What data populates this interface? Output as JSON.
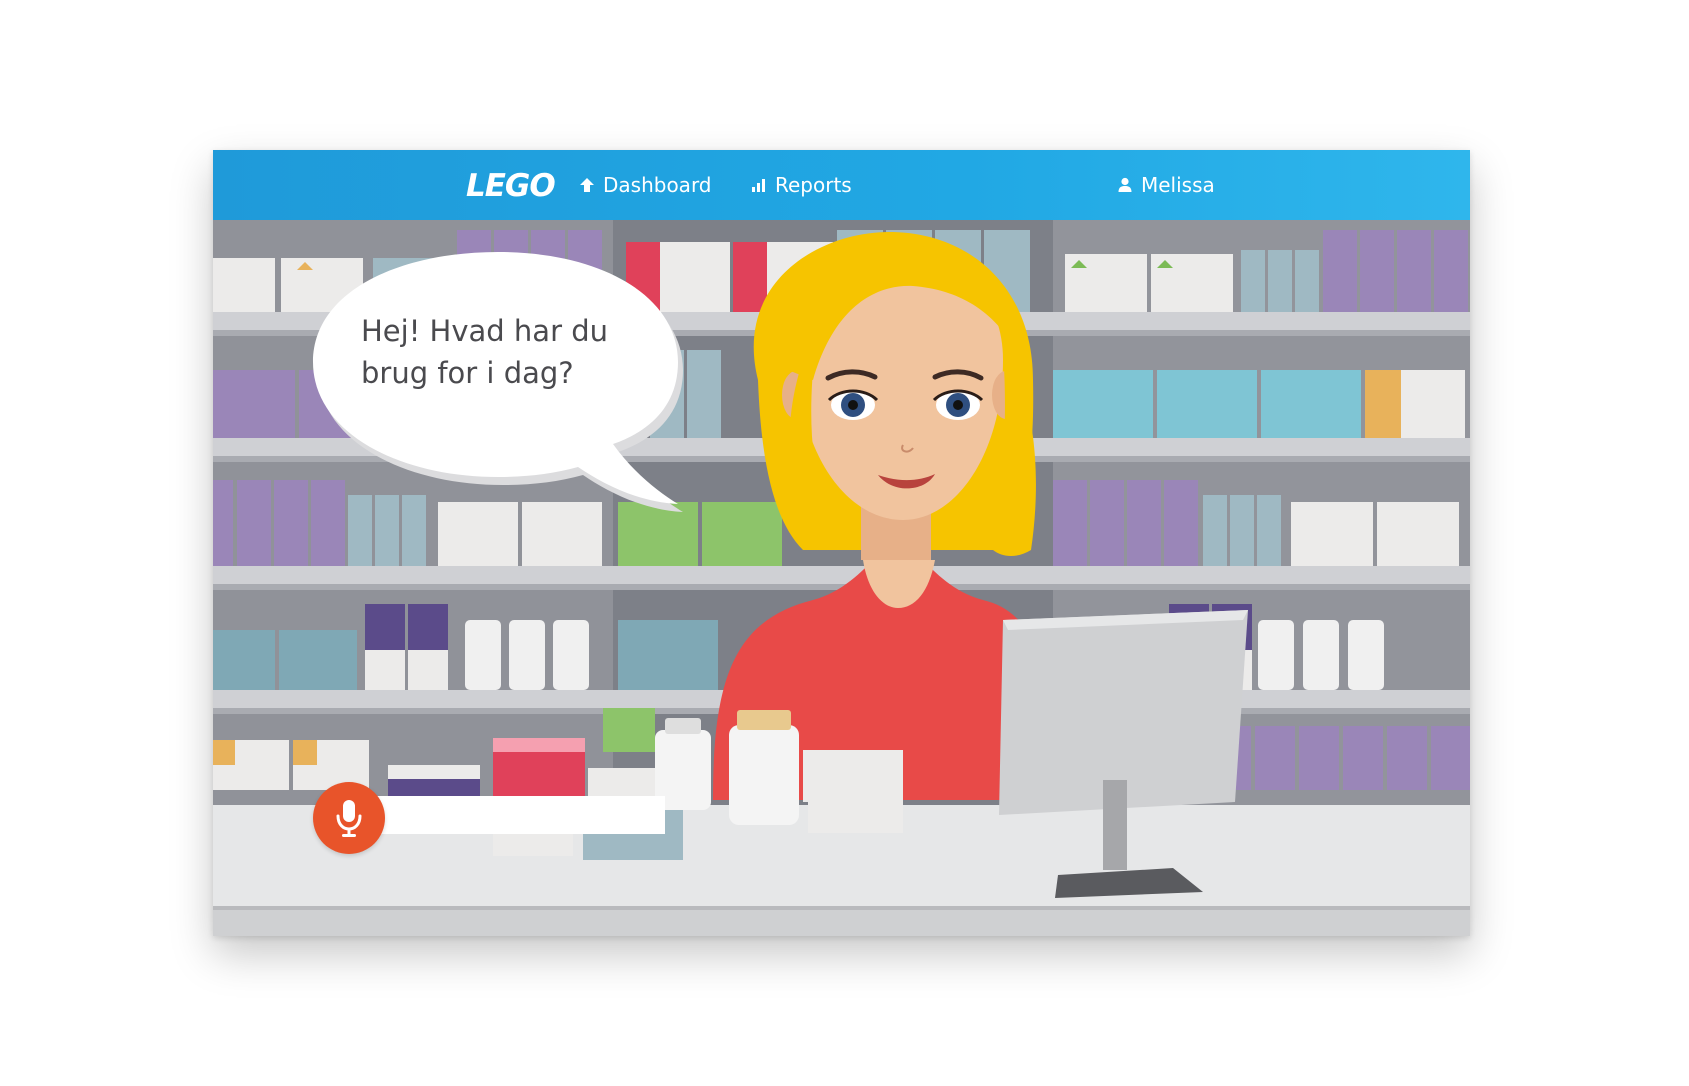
{
  "navbar": {
    "logo": "LEGO",
    "items": [
      {
        "label": "Dashboard",
        "icon": "arrow-up-icon"
      },
      {
        "label": "Reports",
        "icon": "bar-chart-icon"
      }
    ],
    "user": {
      "label": "Melissa",
      "icon": "user-icon"
    }
  },
  "assistant": {
    "speech": [
      "Hej! Hvad har du",
      "brug for i dag?"
    ]
  },
  "voice_input": {
    "value": "",
    "placeholder": "",
    "icon": "microphone-icon"
  },
  "colors": {
    "navbar": "#21a8e4",
    "mic_button": "#e8542a",
    "hair": "#f6c400",
    "shirt": "#e84a48",
    "shelf": "#c9c9ce",
    "counter": "#e6e7e8"
  }
}
